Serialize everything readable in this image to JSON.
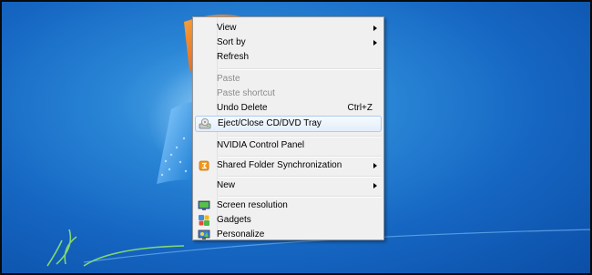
{
  "context_menu": {
    "items": [
      {
        "label": "View",
        "submenu": true
      },
      {
        "label": "Sort by",
        "submenu": true
      },
      {
        "label": "Refresh"
      },
      {
        "label": "Paste",
        "disabled": true
      },
      {
        "label": "Paste shortcut",
        "disabled": true
      },
      {
        "label": "Undo Delete",
        "shortcut": "Ctrl+Z"
      },
      {
        "label": "Eject/Close CD/DVD Tray",
        "icon": "cd-drive-icon",
        "highlighted": true
      },
      {
        "label": "NVIDIA Control Panel"
      },
      {
        "label": "Shared Folder Synchronization",
        "icon": "sync-icon",
        "submenu": true
      },
      {
        "label": "New",
        "submenu": true
      },
      {
        "label": "Screen resolution",
        "icon": "display-icon"
      },
      {
        "label": "Gadgets",
        "icon": "gadgets-icon"
      },
      {
        "label": "Personalize",
        "icon": "personalize-icon"
      }
    ]
  },
  "colors": {
    "desktop": "#1566c2",
    "menu_background": "#f0f0f0",
    "highlight_border": "#aecbf0",
    "disabled_text": "#8d8d8d"
  }
}
